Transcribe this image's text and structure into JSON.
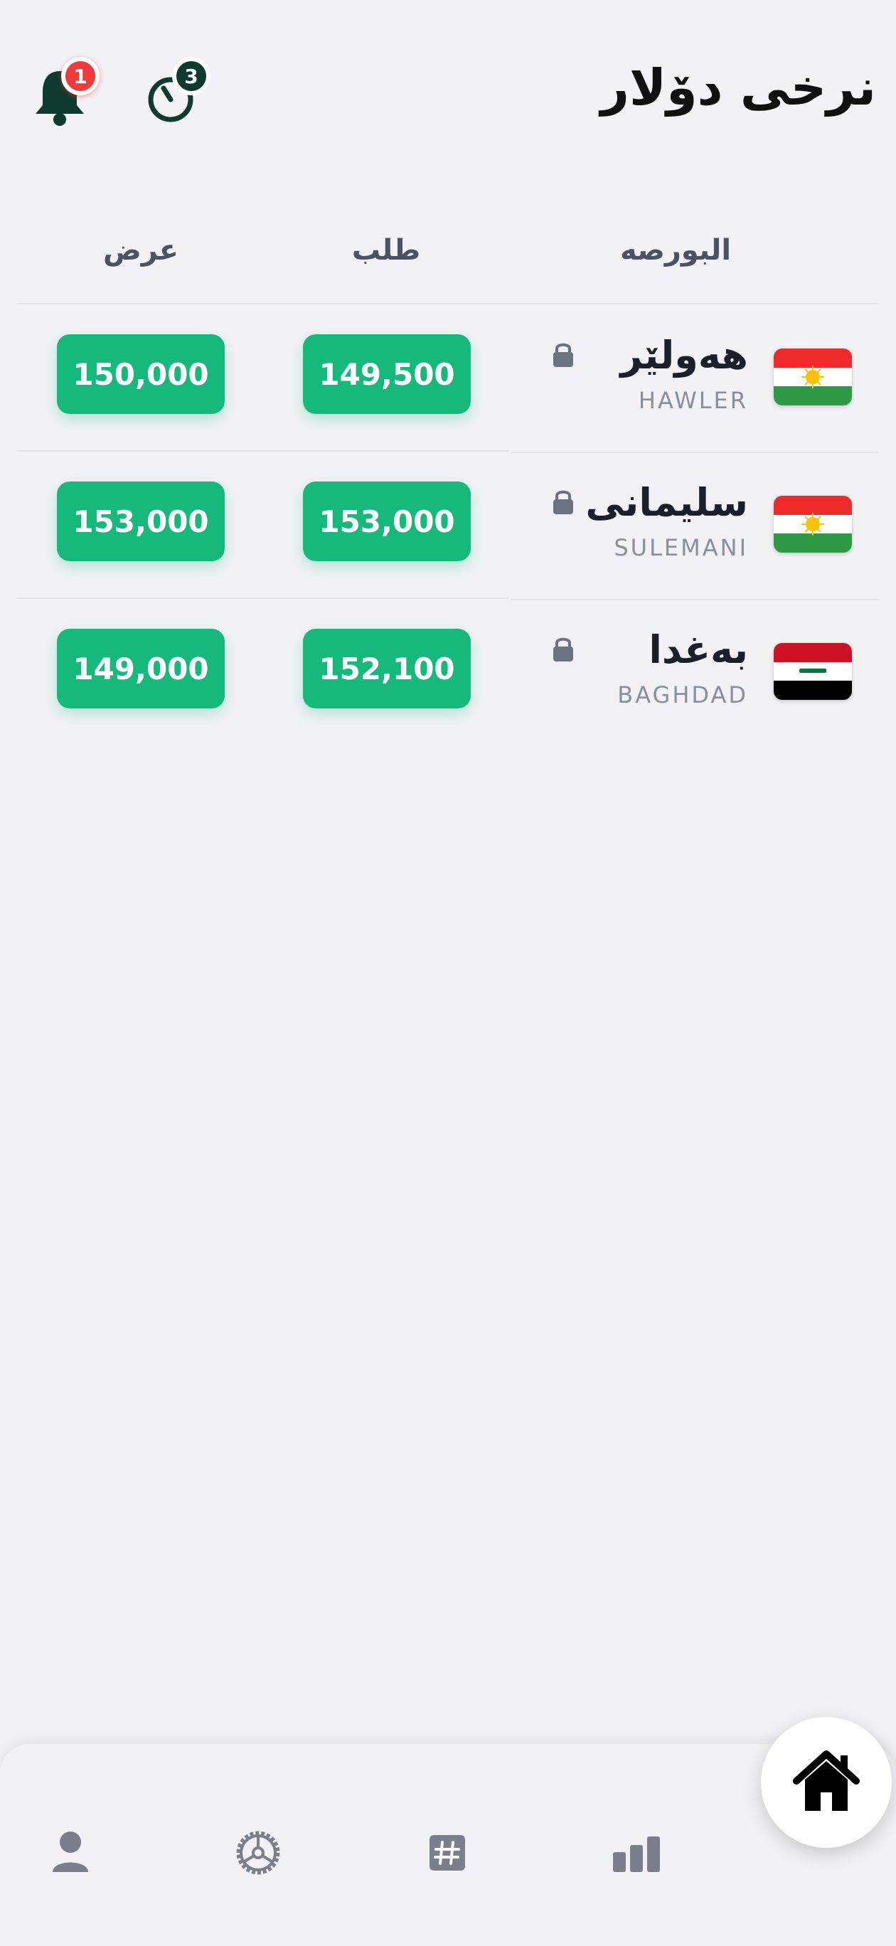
{
  "header": {
    "title": "نرخی دۆلار",
    "notifications_badge": "1",
    "timer_badge": "3"
  },
  "table": {
    "columns": {
      "exchange": "البورصه",
      "bid": "طلب",
      "ask": "عرض"
    },
    "rows": [
      {
        "city": "هەولێر",
        "city_latin": "HAWLER",
        "flag": "kurdistan",
        "bid": "149,500",
        "ask": "150,000",
        "locked": true
      },
      {
        "city": "سلیمانی",
        "city_latin": "SULEMANI",
        "flag": "kurdistan",
        "bid": "153,000",
        "ask": "153,000",
        "locked": true
      },
      {
        "city": "بەغدا",
        "city_latin": "BAGHDAD",
        "flag": "iraq",
        "bid": "152,100",
        "ask": "149,000",
        "locked": true
      }
    ]
  },
  "bottom_nav": {
    "items": [
      {
        "icon": "user-icon"
      },
      {
        "icon": "gear-icon"
      },
      {
        "icon": "hash-icon"
      },
      {
        "icon": "bar-chart-icon"
      },
      {
        "icon": "home-icon",
        "active": true
      }
    ]
  },
  "colors": {
    "accent": "#16b97b",
    "badge_red": "#ef3b3b",
    "badge_dark": "#0e3b2e",
    "icon_dark": "#0e3b2e",
    "background": "#f2f2f6"
  }
}
